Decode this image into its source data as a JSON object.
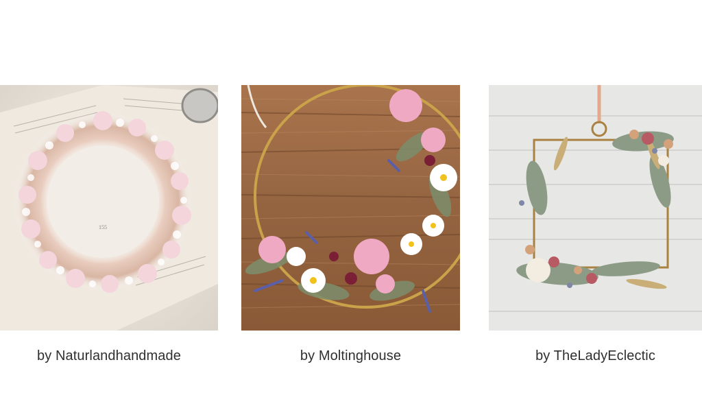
{
  "gallery": {
    "items": [
      {
        "caption": "by Naturlandhandmade",
        "image": "pink-baby-breath-wreath-on-book"
      },
      {
        "caption": "by Moltinghouse",
        "image": "gold-hoop-floral-wreath-on-wood"
      },
      {
        "caption": "by TheLadyEclectic",
        "image": "square-brass-frame-dried-flowers"
      }
    ]
  }
}
